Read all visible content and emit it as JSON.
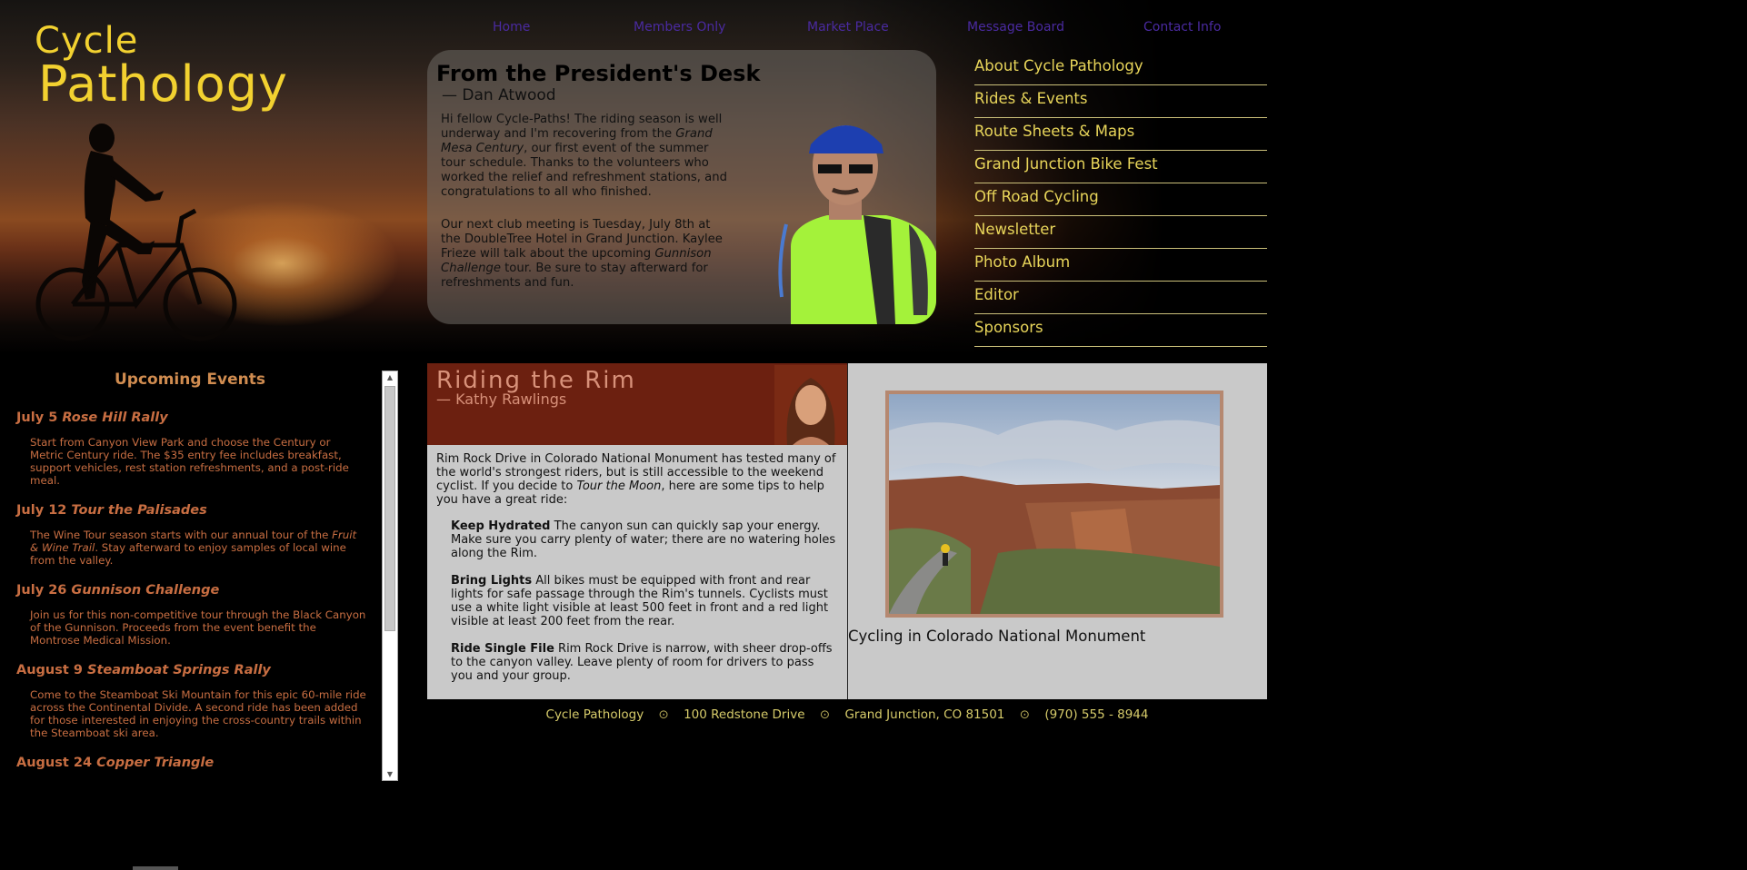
{
  "brand": {
    "line1": "Cycle",
    "line2": "Pathology"
  },
  "topnav": [
    "Home",
    "Members Only",
    "Market Place",
    "Message Board",
    "Contact Info"
  ],
  "president": {
    "title": "From the President's Desk",
    "byline": "— Dan Atwood",
    "para1_a": "Hi fellow Cycle-Paths! The riding season is well underway and I'm recovering from the ",
    "para1_em": "Grand Mesa Century",
    "para1_b": ", our first event of the summer tour schedule. Thanks to the volunteers who worked the relief and refreshment stations, and congratulations to all who finished.",
    "para2_a": "Our next club meeting is Tuesday, July 8th at the DoubleTree Hotel in Grand Junction. Kaylee Frieze will talk about the upcoming ",
    "para2_em": "Gunnison Challenge",
    "para2_b": " tour. Be sure to stay afterward for refreshments and fun."
  },
  "menu": [
    "About Cycle Pathology",
    "Rides & Events",
    "Route Sheets & Maps",
    "Grand Junction Bike Fest",
    "Off Road Cycling",
    "Newsletter",
    "Photo Album",
    "Editor",
    "Sponsors"
  ],
  "events": {
    "heading": "Upcoming Events",
    "items": [
      {
        "date": "July 5 ",
        "name": "Rose Hill Rally",
        "desc": "Start from Canyon View Park and choose the Century or Metric Century ride. The $35 entry fee includes breakfast, support vehicles, rest station refreshments, and a post-ride meal."
      },
      {
        "date": "July 12 ",
        "name": "Tour the Palisades",
        "desc_a": "The Wine Tour season starts with our annual tour of the ",
        "desc_em": "Fruit & Wine Trail",
        "desc_b": ". Stay afterward to enjoy samples of local wine from the valley."
      },
      {
        "date": "July 26 ",
        "name": "Gunnison Challenge",
        "desc": "Join us for this non-competitive tour through the Black Canyon of the Gunnison. Proceeds from the event benefit the Montrose Medical Mission."
      },
      {
        "date": "August 9 ",
        "name": "Steamboat Springs Rally",
        "desc": "Come to the Steamboat Ski Mountain for this epic 60-mile ride across the Continental Divide. A second ride has been added for those interested in enjoying the cross-country trails within the Steamboat ski area."
      },
      {
        "date": "August 24 ",
        "name": "Copper Triangle"
      }
    ]
  },
  "article": {
    "title": "Riding the Rim",
    "byline": "— Kathy Rawlings",
    "intro_a": "Rim Rock Drive in Colorado National Monument has tested many of the world's strongest riders, but is still accessible to the weekend cyclist. If you decide to ",
    "intro_em": "Tour the Moon",
    "intro_b": ", here are some tips to help you have a great ride:",
    "tips": [
      {
        "head": "Keep Hydrated",
        "text": " The canyon sun can quickly sap your energy. Make sure you carry plenty of water; there are no watering holes along the Rim."
      },
      {
        "head": "Bring Lights",
        "text": " All bikes must be equipped with front and rear lights for safe passage through the Rim's tunnels. Cyclists must use a white light visible at least 500 feet in front and a red light visible at least 200 feet from the rear."
      },
      {
        "head": "Ride Single File",
        "text": " Rim Rock Drive is narrow, with sheer drop-offs to the canyon valley. Leave plenty of room for drivers to pass you and your group."
      }
    ],
    "caption": "Cycling in Colorado National Monument"
  },
  "footer": [
    "Cycle Pathology",
    "100 Redstone Drive",
    "Grand Junction, CO 81501",
    "(970) 555 - 8944"
  ],
  "footer_sep": "⊙",
  "colors": {
    "menu_text": "#e8d55a",
    "nav_link": "#4a2aa0",
    "event_text": "#c86e42",
    "article_head": "#6c2010",
    "content_bg": "#c9c9c9"
  }
}
